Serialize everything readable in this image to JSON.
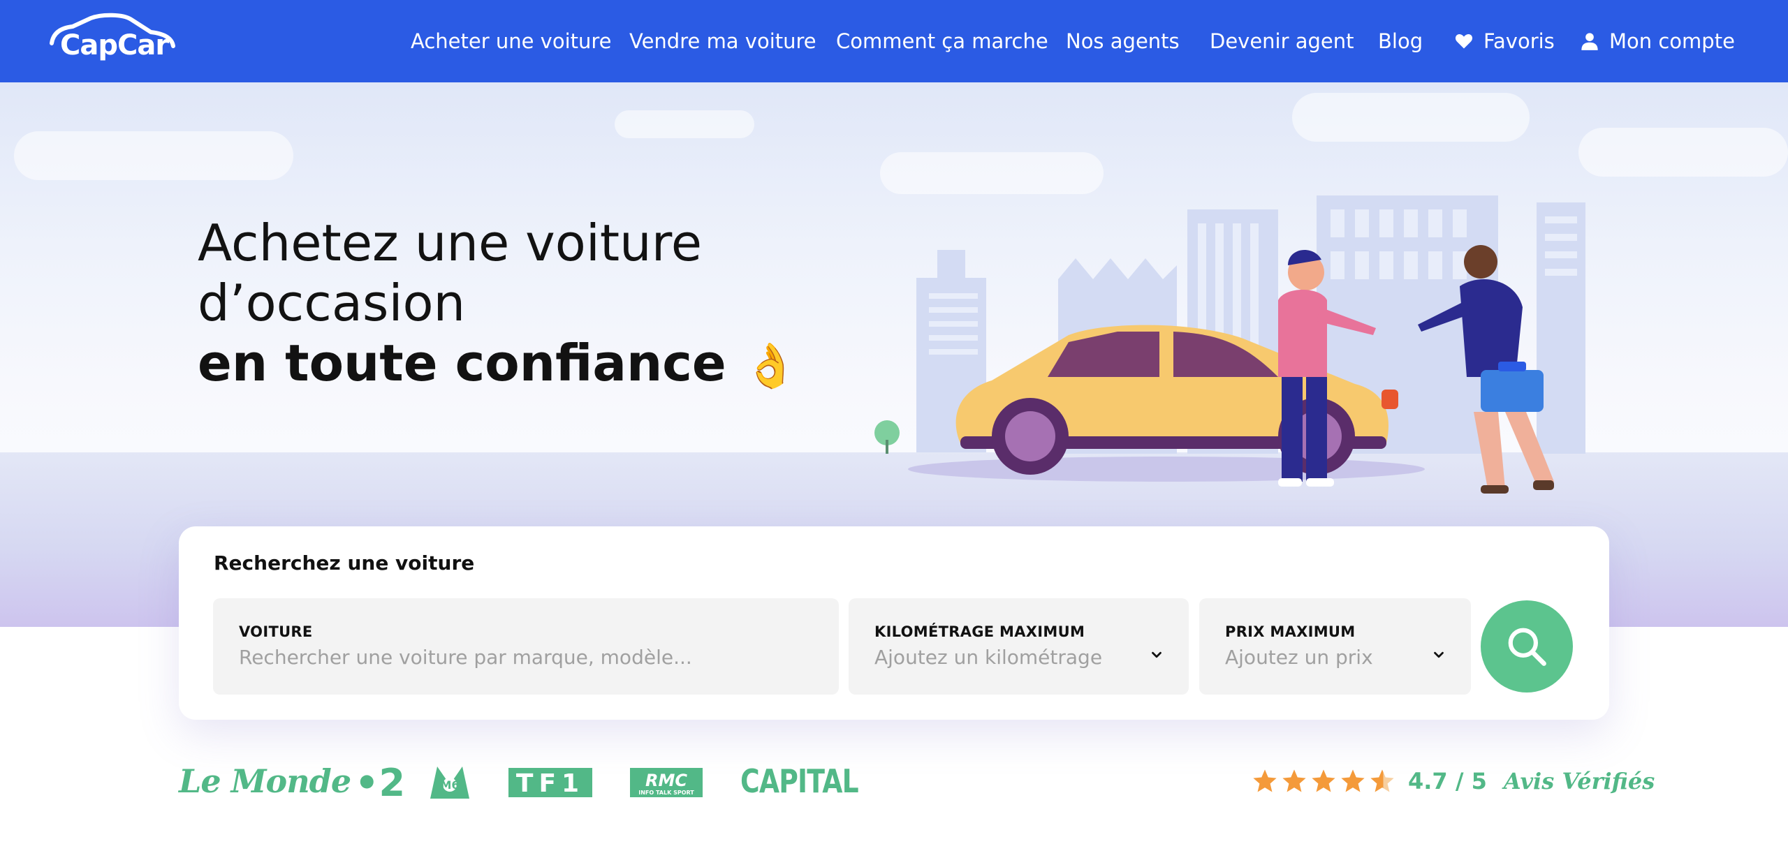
{
  "header": {
    "logo_text": "CapCar",
    "nav": [
      {
        "label": "Acheter une voiture"
      },
      {
        "label": "Vendre ma voiture"
      },
      {
        "label": "Comment ça marche"
      },
      {
        "label": "Nos agents"
      },
      {
        "label": "Devenir agent"
      },
      {
        "label": "Blog"
      },
      {
        "label": "Favoris",
        "icon": "heart-icon"
      },
      {
        "label": "Mon compte",
        "icon": "user-icon"
      }
    ]
  },
  "hero": {
    "line1": "Achetez une voiture",
    "line2": "d’occasion",
    "line3": "en toute confiance",
    "emoji": "👌"
  },
  "search": {
    "title": "Recherchez une voiture",
    "voiture": {
      "label": "VOITURE",
      "placeholder": "Rechercher une voiture par marque, modèle..."
    },
    "km": {
      "label": "KILOMÉTRAGE MAXIMUM",
      "placeholder": "Ajoutez un kilométrage"
    },
    "prix": {
      "label": "PRIX MAXIMUM",
      "placeholder": "Ajoutez un prix"
    },
    "button_icon": "search-icon"
  },
  "press": {
    "lemonde": "Le Monde",
    "france2": "•2",
    "m6": "M6",
    "tf1": "TF1",
    "rmc": "RMC",
    "rmc_sub": "INFO TALK SPORT",
    "capital": "CAPITAL"
  },
  "rating": {
    "value": 4.7,
    "score_text": "4.7 / 5",
    "label": "Avis Vérifiés"
  },
  "colors": {
    "brand_blue": "#2b5be4",
    "green": "#5cc48e",
    "press_green": "#52b887",
    "star_orange": "#f49a3a"
  }
}
